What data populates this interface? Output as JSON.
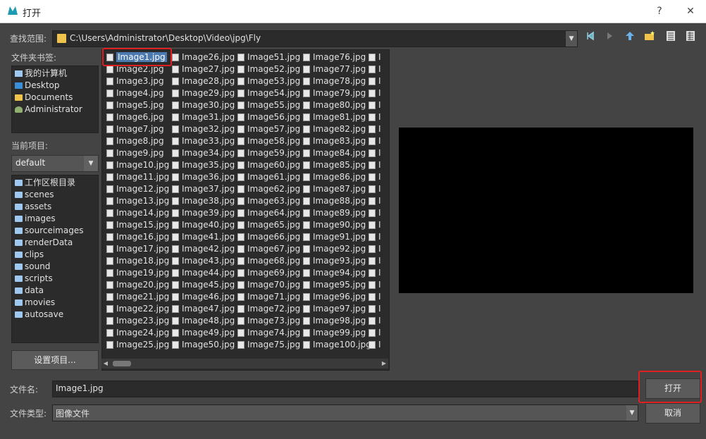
{
  "window": {
    "title": "打开",
    "help": "?",
    "close": "✕"
  },
  "lookin": {
    "label": "查找范围:",
    "path": "C:\\Users\\Administrator\\Desktop\\Video\\jpg\\Fly"
  },
  "bookmarks": {
    "label": "文件夹书签:",
    "items": [
      "我的计算机",
      "Desktop",
      "Documents",
      "Administrator"
    ]
  },
  "project": {
    "label": "当前项目:",
    "current": "default",
    "folders": [
      "工作区根目录",
      "scenes",
      "assets",
      "images",
      "sourceimages",
      "renderData",
      "clips",
      "sound",
      "scripts",
      "data",
      "movies",
      "autosave"
    ],
    "set_button": "设置项目..."
  },
  "files": {
    "selected": "Image1.jpg",
    "columns": [
      [
        "Image1.jpg",
        "Image2.jpg",
        "Image3.jpg",
        "Image4.jpg",
        "Image5.jpg",
        "Image6.jpg",
        "Image7.jpg",
        "Image8.jpg",
        "Image9.jpg",
        "Image10.jpg",
        "Image11.jpg",
        "Image12.jpg",
        "Image13.jpg",
        "Image14.jpg",
        "Image15.jpg",
        "Image16.jpg",
        "Image17.jpg",
        "Image18.jpg",
        "Image19.jpg",
        "Image20.jpg",
        "Image21.jpg",
        "Image22.jpg",
        "Image23.jpg",
        "Image24.jpg",
        "Image25.jpg"
      ],
      [
        "Image26.jpg",
        "Image27.jpg",
        "Image28.jpg",
        "Image29.jpg",
        "Image30.jpg",
        "Image31.jpg",
        "Image32.jpg",
        "Image33.jpg",
        "Image34.jpg",
        "Image35.jpg",
        "Image36.jpg",
        "Image37.jpg",
        "Image38.jpg",
        "Image39.jpg",
        "Image40.jpg",
        "Image41.jpg",
        "Image42.jpg",
        "Image43.jpg",
        "Image44.jpg",
        "Image45.jpg",
        "Image46.jpg",
        "Image47.jpg",
        "Image48.jpg",
        "Image49.jpg",
        "Image50.jpg"
      ],
      [
        "Image51.jpg",
        "Image52.jpg",
        "Image53.jpg",
        "Image54.jpg",
        "Image55.jpg",
        "Image56.jpg",
        "Image57.jpg",
        "Image58.jpg",
        "Image59.jpg",
        "Image60.jpg",
        "Image61.jpg",
        "Image62.jpg",
        "Image63.jpg",
        "Image64.jpg",
        "Image65.jpg",
        "Image66.jpg",
        "Image67.jpg",
        "Image68.jpg",
        "Image69.jpg",
        "Image70.jpg",
        "Image71.jpg",
        "Image72.jpg",
        "Image73.jpg",
        "Image74.jpg",
        "Image75.jpg"
      ],
      [
        "Image76.jpg",
        "Image77.jpg",
        "Image78.jpg",
        "Image79.jpg",
        "Image80.jpg",
        "Image81.jpg",
        "Image82.jpg",
        "Image83.jpg",
        "Image84.jpg",
        "Image85.jpg",
        "Image86.jpg",
        "Image87.jpg",
        "Image88.jpg",
        "Image89.jpg",
        "Image90.jpg",
        "Image91.jpg",
        "Image92.jpg",
        "Image93.jpg",
        "Image94.jpg",
        "Image95.jpg",
        "Image96.jpg",
        "Image97.jpg",
        "Image98.jpg",
        "Image99.jpg",
        "Image100.jpg"
      ],
      [
        "I",
        "I",
        "I",
        "I",
        "I",
        "I",
        "I",
        "I",
        "I",
        "I",
        "I",
        "I",
        "I",
        "I",
        "I",
        "I",
        "I",
        "I",
        "I",
        "I",
        "I",
        "I",
        "I",
        "I",
        "I"
      ]
    ]
  },
  "filename": {
    "label": "文件名:",
    "value": "Image1.jpg"
  },
  "filetype": {
    "label": "文件类型:",
    "value": "图像文件"
  },
  "buttons": {
    "open": "打开",
    "cancel": "取消"
  },
  "icons": {
    "app": "maya-logo-icon",
    "back": "back-arrow-icon",
    "forward": "forward-arrow-icon",
    "up": "up-folder-icon",
    "new_folder": "new-folder-icon",
    "list_view": "list-view-icon",
    "detail_view": "detail-view-icon"
  },
  "colors": {
    "highlight": "#e02020",
    "selection": "#4a7ab0"
  }
}
